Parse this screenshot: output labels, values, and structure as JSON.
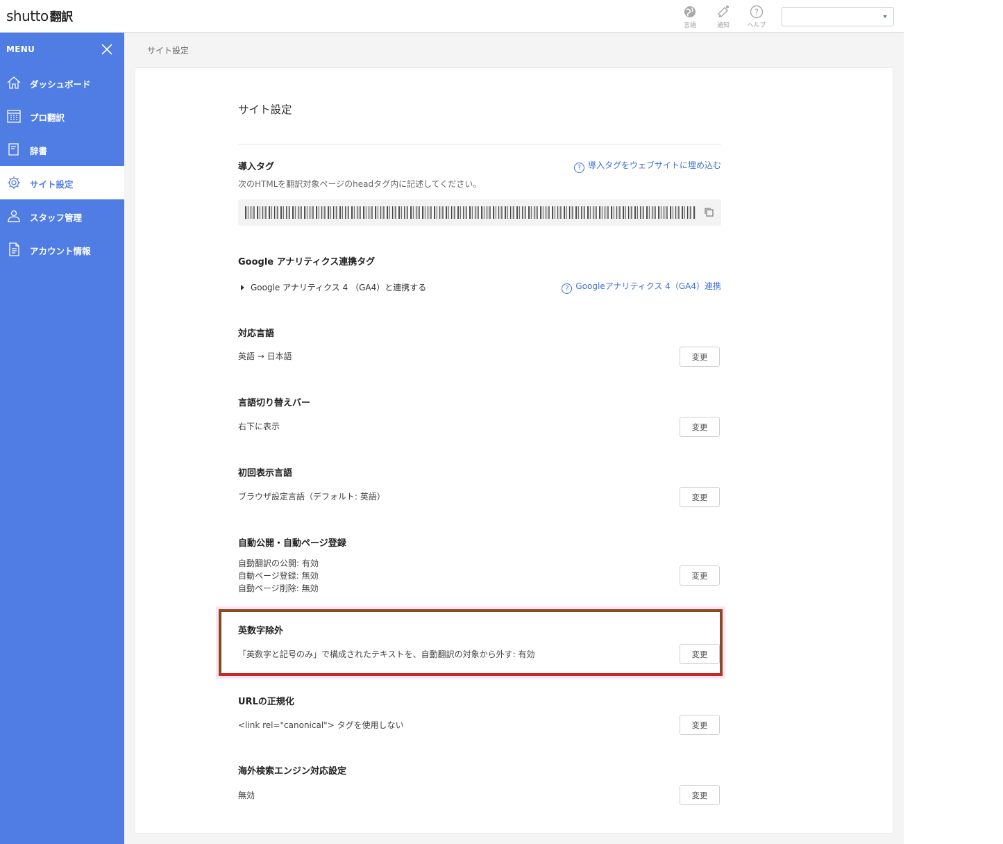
{
  "header": {
    "logo_latin": "shutto",
    "logo_jp": "翻訳",
    "icons": [
      {
        "name": "globe-icon",
        "caption": "言語"
      },
      {
        "name": "bell-icon",
        "caption": "通知"
      },
      {
        "name": "help-icon",
        "caption": "ヘルプ"
      }
    ],
    "site_select_value": ""
  },
  "sidebar": {
    "menu_label": "MENU",
    "items": [
      {
        "label": "ダッシュボード",
        "icon": "home-icon"
      },
      {
        "label": "プロ翻訳",
        "icon": "calendar-icon"
      },
      {
        "label": "辞書",
        "icon": "book-icon"
      },
      {
        "label": "サイト設定",
        "icon": "gear-icon",
        "active": true
      },
      {
        "label": "スタッフ管理",
        "icon": "staff-icon"
      },
      {
        "label": "アカウント情報",
        "icon": "document-icon"
      }
    ]
  },
  "breadcrumb": "サイト設定",
  "page_title": "サイト設定",
  "sections": {
    "install_tag": {
      "title": "導入タグ",
      "help_link": "導入タグをウェブサイトに埋め込む",
      "description": "次のHTMLを翻訳対象ページのheadタグ内に記述してください。"
    },
    "ga": {
      "title": "Google アナリティクス連携タグ",
      "disclosure": "Google アナリティクス 4 （GA4）と連携する",
      "help_link": "Googleアナリティクス 4（GA4）連携"
    },
    "languages": {
      "title": "対応言語",
      "value": "英語 → 日本語",
      "button": "変更"
    },
    "switch_bar": {
      "title": "言語切り替えバー",
      "value": "右下に表示",
      "button": "変更"
    },
    "initial_lang": {
      "title": "初回表示言語",
      "value": "ブラウザ設定言語（デフォルト: 英語）",
      "button": "変更"
    },
    "auto_publish": {
      "title": "自動公開・自動ページ登録",
      "lines": [
        "自動翻訳の公開: 有効",
        "自動ページ登録: 無効",
        "自動ページ削除: 無効"
      ],
      "button": "変更"
    },
    "alnum_exclude": {
      "title": "英数字除外",
      "value": "「英数字と記号のみ」で構成されたテキストを、自動翻訳の対象から外す: 有効",
      "button": "変更"
    },
    "url_canonical": {
      "title": "URLの正規化",
      "value": "<link rel=\"canonical\"> タグを使用しない",
      "button": "変更"
    },
    "overseas_seo": {
      "title": "海外検索エンジン対応設定",
      "value": "無効",
      "button": "変更"
    }
  },
  "colors": {
    "sidebar": "#4f7de3",
    "link": "#3d6fd6",
    "highlight_border": "#c62828"
  }
}
